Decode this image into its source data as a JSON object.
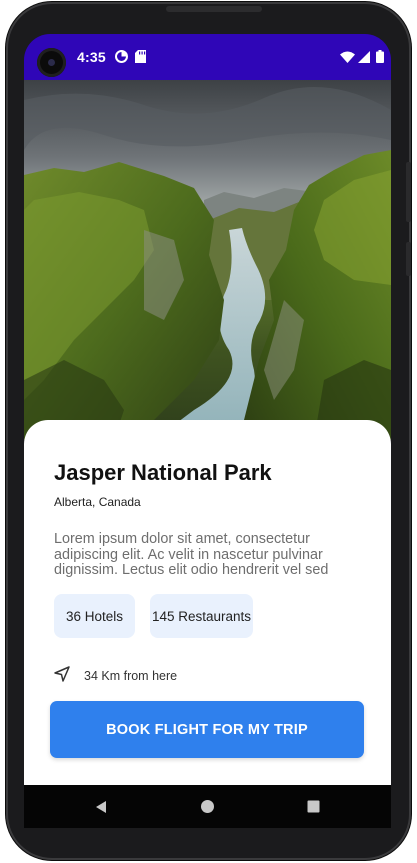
{
  "status_bar": {
    "time": "4:35",
    "left_icons": [
      "data-saver-icon",
      "sd-card-icon"
    ],
    "right_icons": [
      "wifi-icon",
      "cell-signal-icon",
      "battery-icon"
    ],
    "background": "#2f06b7"
  },
  "carousel": {
    "image": "canyon landscape with river",
    "page_count": 5,
    "active_index": 2
  },
  "place": {
    "title": "Jasper National Park",
    "location": "Alberta, Canada",
    "description": "Lorem ipsum dolor sit amet, consectetur adipiscing elit. Ac velit in nascetur pulvinar dignissim. Lectus elit odio hendrerit vel sed"
  },
  "chips": [
    {
      "label": "36 Hotels"
    },
    {
      "label": "145 Restaurants"
    }
  ],
  "distance": {
    "icon": "navigation-arrow-icon",
    "text": "34 Km from here"
  },
  "cta": {
    "label": "BOOK FLIGHT FOR MY TRIP",
    "color": "#2f80ed"
  },
  "nav_bar": {
    "buttons": [
      "back-icon",
      "home-icon",
      "recents-icon"
    ]
  }
}
